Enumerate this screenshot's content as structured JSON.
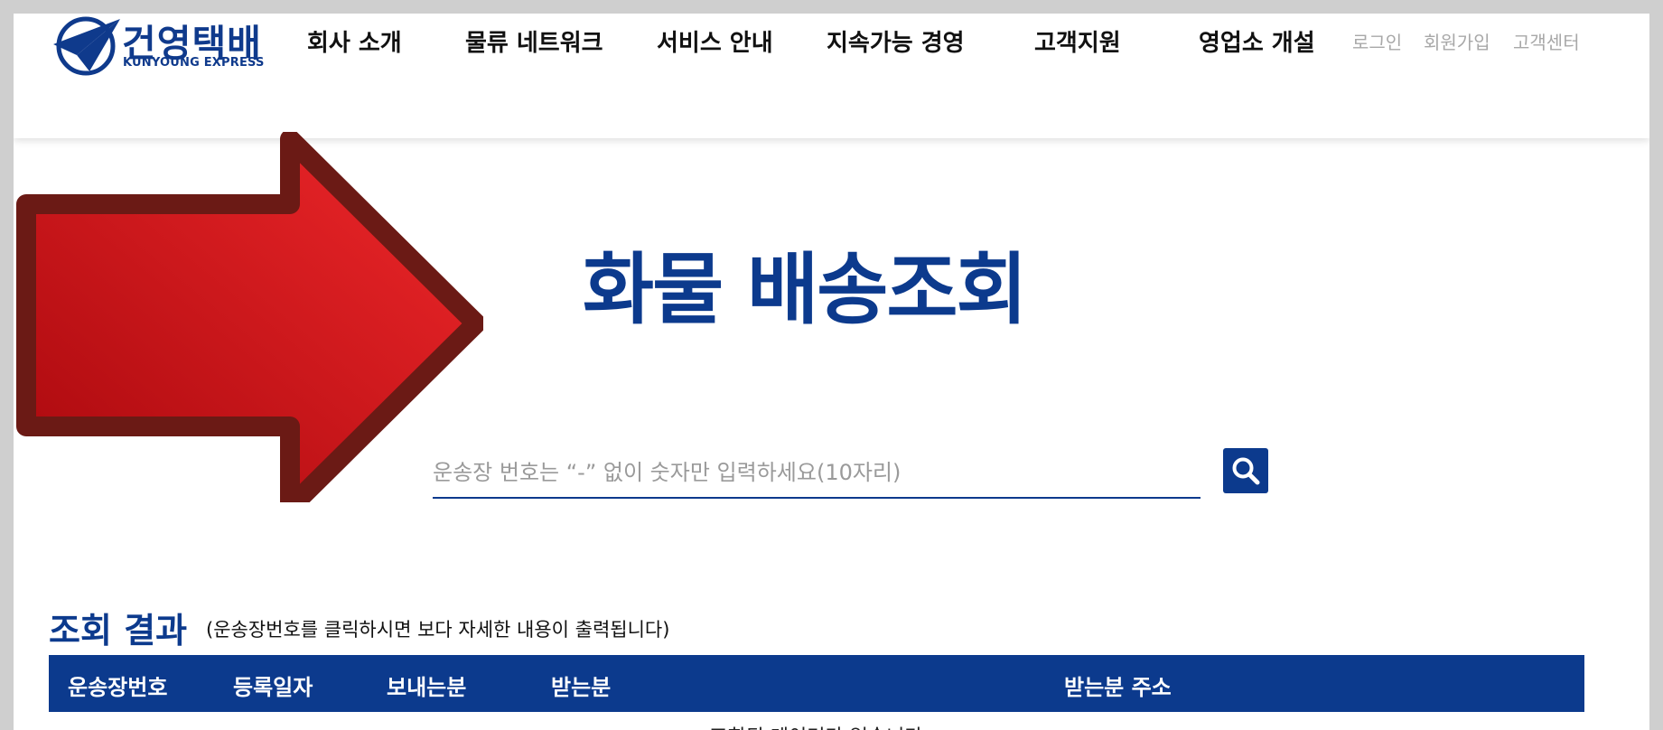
{
  "header": {
    "logo": {
      "name_ko": "건영택배",
      "name_en": "KUNYOUNG EXPRESS"
    },
    "nav": [
      {
        "label": "회사 소개"
      },
      {
        "label": "물류 네트워크"
      },
      {
        "label": "서비스 안내"
      },
      {
        "label": "지속가능 경영"
      },
      {
        "label": "고객지원"
      },
      {
        "label": "영업소 개설"
      }
    ],
    "utility": [
      {
        "label": "로그인"
      },
      {
        "label": "회원가입"
      },
      {
        "label": "고객센터"
      }
    ]
  },
  "main": {
    "title": "화물 배송조회",
    "search": {
      "placeholder": "운송장 번호는 “-” 없이 숫자만 입력하세요(10자리)",
      "value": "",
      "button_icon": "search-icon"
    },
    "results": {
      "title": "조회 결과",
      "note": "(운송장번호를 클릭하시면 보다 자세한 내용이 출력됩니다)",
      "columns": [
        "운송장번호",
        "등록일자",
        "보내는분",
        "받는분",
        "받는분 주소"
      ],
      "below_text": "조회된 데이터가 없습니다"
    }
  },
  "annotation": {
    "icon": "red-arrow-icon"
  },
  "colors": {
    "brand": "#0c3a8d",
    "arrow_fill": "#e3252a",
    "arrow_stroke": "#6b1a15",
    "frame_border": "#cfcfcf"
  }
}
